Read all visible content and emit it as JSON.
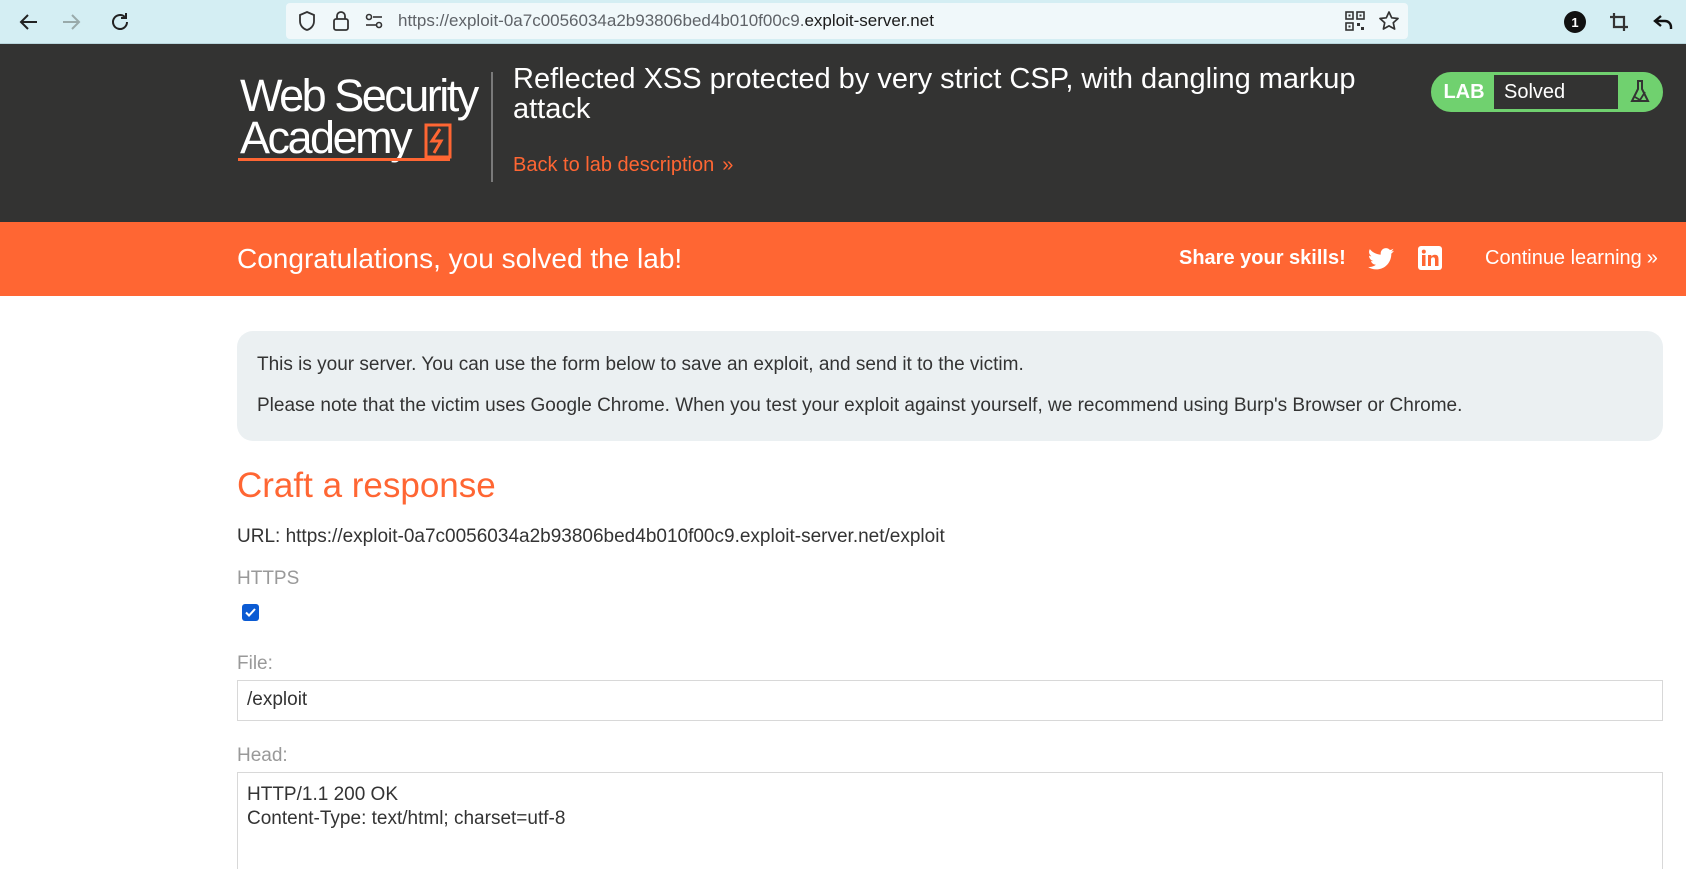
{
  "browser": {
    "url_prefix": "https://exploit-0a7c0056034a2b93806bed4b010f00c9.",
    "url_host": "exploit-server.net",
    "extension_badge": "1"
  },
  "header": {
    "logo_line1": "Web Security",
    "logo_line2": "Academy",
    "lab_title": "Reflected XSS protected by very strict CSP, with dangling markup attack",
    "back_link": "Back to lab description",
    "back_chevron": "»",
    "lab_badge": {
      "label": "LAB",
      "status": "Solved"
    }
  },
  "banner": {
    "message": "Congratulations, you solved the lab!",
    "share_label": "Share your skills!",
    "continue_label": "Continue learning",
    "continue_chevron": "»"
  },
  "info": {
    "line1": "This is your server. You can use the form below to save an exploit, and send it to the victim.",
    "line2": "Please note that the victim uses Google Chrome. When you test your exploit against yourself, we recommend using Burp's Browser or Chrome."
  },
  "form": {
    "heading": "Craft a response",
    "url_line": "URL: https://exploit-0a7c0056034a2b93806bed4b010f00c9.exploit-server.net/exploit",
    "https_label": "HTTPS",
    "https_checked": true,
    "file_label": "File:",
    "file_value": "/exploit",
    "head_label": "Head:",
    "head_value": "HTTP/1.1 200 OK\nContent-Type: text/html; charset=utf-8"
  },
  "colors": {
    "accent": "#ff6633",
    "header_bg": "#333332",
    "solved_green": "#70d16f",
    "info_bg": "#ebf0f2"
  }
}
